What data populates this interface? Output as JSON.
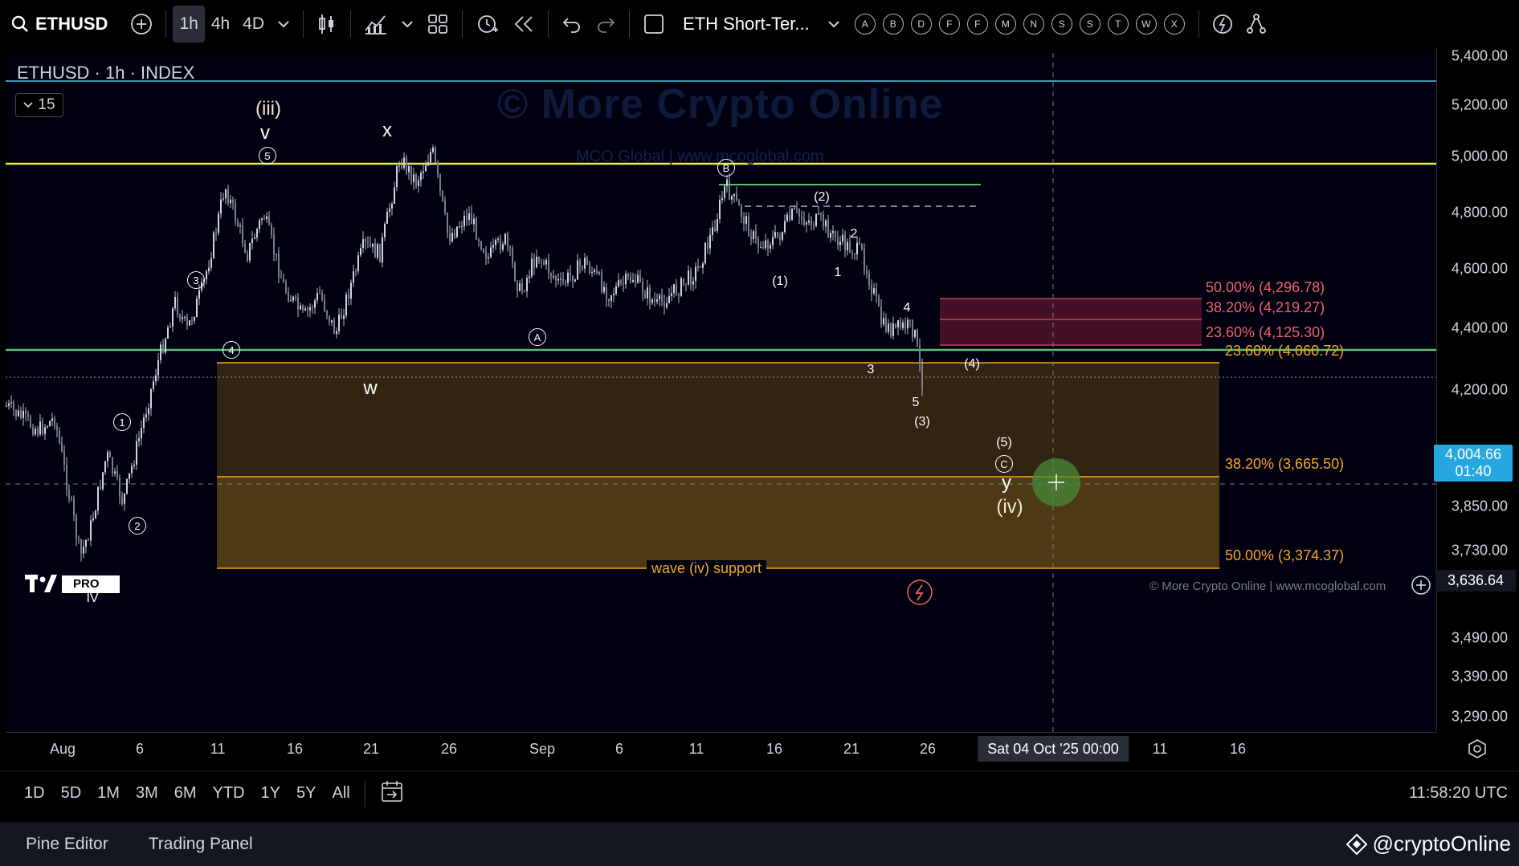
{
  "toolbar": {
    "symbol": "ETHUSD",
    "intervals": [
      "1h",
      "4h",
      "4D"
    ],
    "active_interval": "1h",
    "layout_name": "ETH Short-Ter...",
    "alpha_buttons": [
      "A",
      "B",
      "D",
      "F",
      "F",
      "M",
      "N",
      "S",
      "S",
      "T",
      "W",
      "X"
    ]
  },
  "chart": {
    "title": "ETHUSD · 1h · INDEX",
    "indicator_count": "15",
    "watermark": "© More Crypto Online",
    "watermark_sub": "MCO Global  |  www.mcoglobal.com",
    "copyright": "© More Crypto Online  |  www.mcoglobal.com",
    "support_label": "wave (iv) support",
    "logo_badge": "PRO"
  },
  "fib_levels": [
    {
      "text": "50.00% (4,296.78)",
      "color": "#f0626a"
    },
    {
      "text": "38.20% (4,219.27)",
      "color": "#f0626a"
    },
    {
      "text": "23.60% (4,125.30)",
      "color": "#f0626a"
    },
    {
      "text": "23.60% (4,060.72)",
      "color": "#f5a623"
    },
    {
      "text": "38.20% (3,665.50)",
      "color": "#f5a623"
    },
    {
      "text": "50.00% (3,374.37)",
      "color": "#f5a623"
    }
  ],
  "wave_labels": {
    "iii": "(iii)",
    "v": "v",
    "five_circ": "5",
    "x": "x",
    "B": "B",
    "two_p": "(2)",
    "two": "2",
    "one_p": "(1)",
    "one": "1",
    "three_circ": "3",
    "four_circ": "4",
    "A": "A",
    "w": "w",
    "four": "4",
    "three": "3",
    "four_p": "(4)",
    "five": "5",
    "three_p": "(3)",
    "five_p": "(5)",
    "C": "C",
    "y": "y",
    "iv": "(iv)",
    "one_circ": "1",
    "two_circ": "2",
    "IV": "IV"
  },
  "price_axis": {
    "ticks": [
      "5,400.00",
      "5,200.00",
      "5,000.00",
      "4,800.00",
      "4,600.00",
      "4,400.00",
      "4,200.00",
      "3,850.00",
      "3,730.00",
      "3,490.00",
      "3,390.00",
      "3,290.00"
    ],
    "current_price": "4,004.66",
    "countdown": "01:40",
    "crosshair_price": "3,636.64"
  },
  "time_axis": {
    "ticks": [
      "Aug",
      "6",
      "11",
      "16",
      "21",
      "26",
      "Sep",
      "6",
      "11",
      "16",
      "21",
      "26",
      "11",
      "16"
    ],
    "crosshair_time": "Sat 04 Oct '25   00:00"
  },
  "range_buttons": [
    "1D",
    "5D",
    "1M",
    "3M",
    "6M",
    "YTD",
    "1Y",
    "5Y",
    "All"
  ],
  "clock": "11:58:20 UTC",
  "bottom_tabs": [
    "Pine Editor",
    "Trading Panel"
  ],
  "handle": "@cryptoOnline",
  "colors": {
    "yellow_line": "#f0e64a",
    "green_line": "#5cbf6e",
    "cyan_line": "#56c9e8",
    "support_fill": "#5e3e14",
    "resistance_fill": "#6e1f35",
    "price_tag": "#26a7e0"
  }
}
